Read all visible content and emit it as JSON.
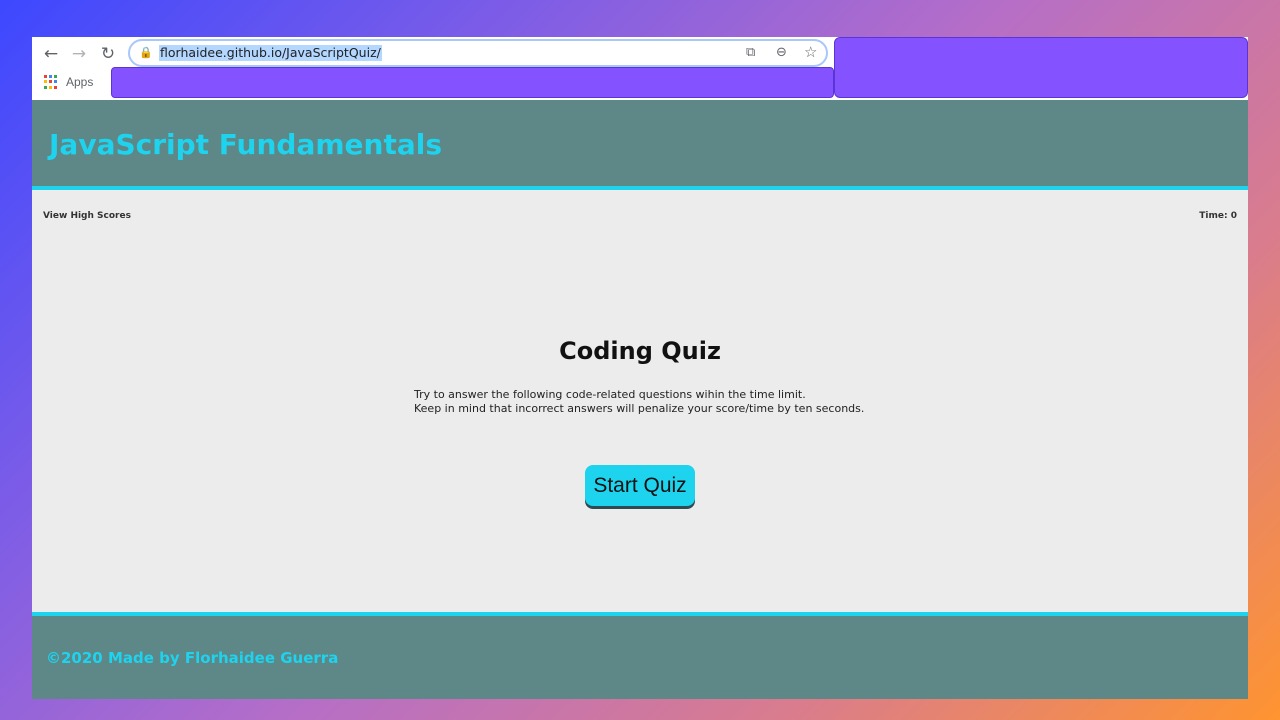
{
  "browser": {
    "url": "florhaidee.github.io/JavaScriptQuiz/",
    "back_icon": "←",
    "forward_icon": "→",
    "reload_icon": "↻",
    "lock_icon": "🔒",
    "cast_icon": "⧉",
    "zoom_icon": "⊖",
    "star_icon": "☆",
    "bookmarks": {
      "apps_label": "Apps"
    }
  },
  "header": {
    "title": "JavaScript Fundamentals"
  },
  "topbar": {
    "high_scores": "View High Scores",
    "timer": "Time: 0"
  },
  "main": {
    "title": "Coding Quiz",
    "instructions_line1": "Try to answer the following code-related questions wihin the time limit.",
    "instructions_line2": "Keep in mind that incorrect answers will penalize your score/time by ten seconds.",
    "start_button": "Start Quiz"
  },
  "footer": {
    "text": "©2020 Made by Florhaidee Guerra"
  },
  "colors": {
    "accent": "#1ed3ee",
    "header_bg": "#5e8788",
    "page_bg": "#ececec",
    "redaction": "#8552ff"
  }
}
